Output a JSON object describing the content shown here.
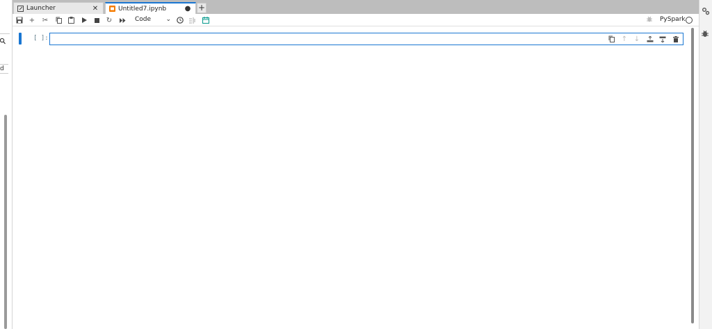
{
  "left_panel": {
    "search_icon": "search-icon",
    "partial_text": "d"
  },
  "tabs": [
    {
      "label": "Launcher",
      "icon": "launcher-icon",
      "close": "✕"
    },
    {
      "label": "Untitled7.ipynb",
      "icon": "notebook-icon",
      "close": "●"
    }
  ],
  "add_tab_label": "+",
  "toolbar": {
    "items": [
      "save-icon",
      "add-cell-icon",
      "cut-icon",
      "copy-icon",
      "paste-icon",
      "run-icon",
      "stop-icon",
      "restart-icon",
      "run-all-icon"
    ],
    "cell_type": "Code",
    "cell_type_chevron": "⌄",
    "kernel_name": "PySpark"
  },
  "cell": {
    "prompt": "[ ]:",
    "source": "",
    "tools": [
      "duplicate-icon",
      "move-up-icon",
      "move-down-icon",
      "insert-above-icon",
      "insert-below-icon",
      "delete-icon"
    ]
  },
  "colors": {
    "accent": "#1976d2",
    "tabbar": "#bdbdbd",
    "prompt": "#607d8b"
  }
}
